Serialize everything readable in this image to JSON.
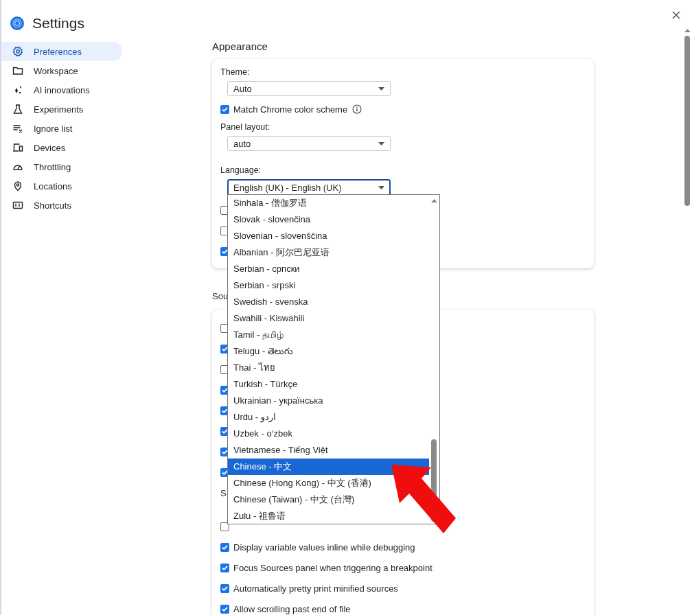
{
  "window": {
    "title": "Settings"
  },
  "sidebar": {
    "items": [
      {
        "label": "Preferences",
        "selected": true
      },
      {
        "label": "Workspace",
        "selected": false
      },
      {
        "label": "AI innovations",
        "selected": false
      },
      {
        "label": "Experiments",
        "selected": false
      },
      {
        "label": "Ignore list",
        "selected": false
      },
      {
        "label": "Devices",
        "selected": false
      },
      {
        "label": "Throttling",
        "selected": false
      },
      {
        "label": "Locations",
        "selected": false
      },
      {
        "label": "Shortcuts",
        "selected": false
      }
    ]
  },
  "appearance": {
    "heading": "Appearance",
    "theme": {
      "label": "Theme:",
      "value": "Auto"
    },
    "match_chrome": {
      "label": "Match Chrome color scheme",
      "checked": true
    },
    "panel_layout": {
      "label": "Panel layout:",
      "value": "auto"
    },
    "language": {
      "label": "Language:",
      "value": "English (UK) - English (UK)",
      "expanded": true
    },
    "checkboxes": [
      {
        "checked": false
      },
      {
        "checked": false
      },
      {
        "checked": true
      }
    ]
  },
  "sources": {
    "heading": "Sou",
    "rows": [
      {
        "kind": "checkbox",
        "checked": false
      },
      {
        "kind": "checkbox",
        "checked": true
      },
      {
        "kind": "checkbox",
        "checked": false
      },
      {
        "kind": "checkbox",
        "checked": true
      },
      {
        "kind": "checkbox",
        "checked": true
      },
      {
        "kind": "checkbox",
        "checked": true
      },
      {
        "kind": "checkbox",
        "checked": true
      },
      {
        "kind": "checkbox",
        "checked": true
      },
      {
        "kind": "text",
        "label": "S"
      },
      {
        "kind": "checkbox",
        "checked": false
      },
      {
        "kind": "checkbox",
        "checked": true,
        "label": "Display variable values inline while debugging"
      },
      {
        "kind": "checkbox",
        "checked": true,
        "label": "Focus Sources panel when triggering a breakpoint"
      },
      {
        "kind": "checkbox",
        "checked": true,
        "label": "Automatically pretty print minified sources"
      },
      {
        "kind": "checkbox",
        "checked": true,
        "label": "Allow scrolling past end of file"
      }
    ]
  },
  "language_dropdown": {
    "options": [
      {
        "label": "Sinhala - 僧伽罗语",
        "selected": false
      },
      {
        "label": "Slovak - slovenčina",
        "selected": false
      },
      {
        "label": "Slovenian - slovenščina",
        "selected": false
      },
      {
        "label": "Albanian - 阿尔巴尼亚语",
        "selected": false
      },
      {
        "label": "Serbian - српски",
        "selected": false
      },
      {
        "label": "Serbian - srpski",
        "selected": false
      },
      {
        "label": "Swedish - svenska",
        "selected": false
      },
      {
        "label": "Swahili - Kiswahili",
        "selected": false
      },
      {
        "label": "Tamil - தமிழ்",
        "selected": false
      },
      {
        "label": "Telugu - తెలుగు",
        "selected": false
      },
      {
        "label": "Thai - ไทย",
        "selected": false
      },
      {
        "label": "Turkish - Türkçe",
        "selected": false
      },
      {
        "label": "Ukrainian - українська",
        "selected": false
      },
      {
        "label": "Urdu - اردو",
        "selected": false
      },
      {
        "label": "Uzbek - o‘zbek",
        "selected": false
      },
      {
        "label": "Vietnamese - Tiếng Việt",
        "selected": false
      },
      {
        "label": "Chinese - 中文",
        "selected": true
      },
      {
        "label": "Chinese (Hong Kong) - 中文 (香港)",
        "selected": false
      },
      {
        "label": "Chinese (Taiwan) - 中文 (台灣)",
        "selected": false
      },
      {
        "label": "Zulu - 祖鲁语",
        "selected": false
      }
    ]
  }
}
